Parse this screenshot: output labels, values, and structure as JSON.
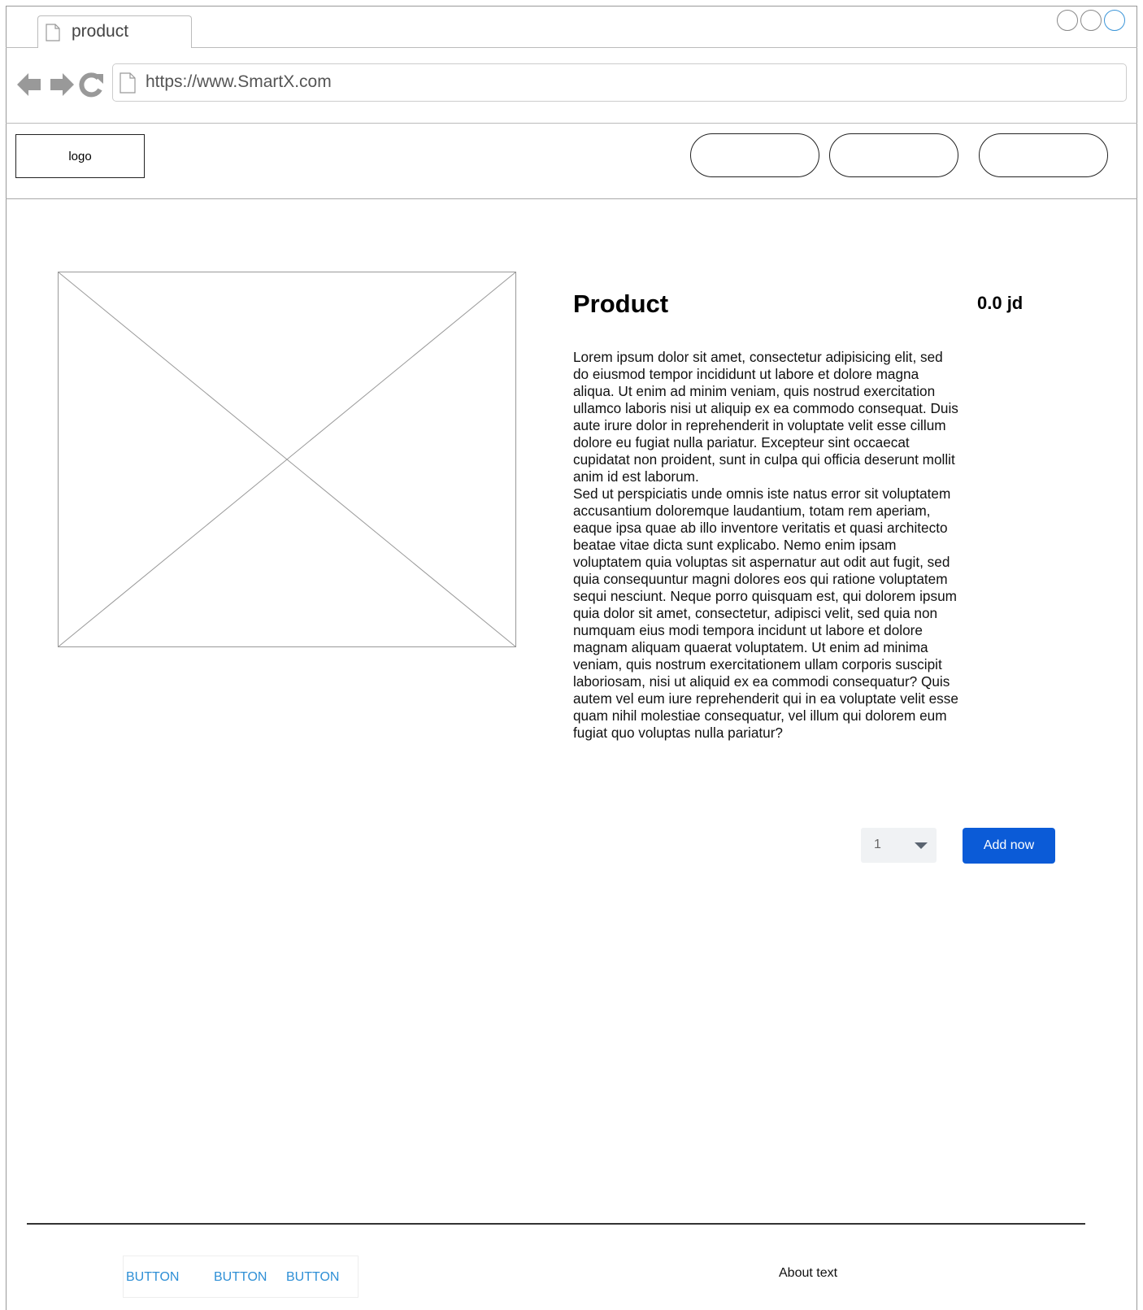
{
  "browser": {
    "tab_title": "product",
    "url": "https://www.SmartX.com"
  },
  "header": {
    "logo_label": "logo"
  },
  "product": {
    "title": "Product",
    "price": "0.0 jd",
    "description": "Lorem ipsum dolor sit amet, consectetur adipisicing elit, sed\ndo eiusmod tempor incididunt ut labore et dolore magna\naliqua. Ut enim ad minim veniam, quis nostrud exercitation\nullamco laboris nisi ut aliquip ex ea commodo consequat. Duis\naute irure dolor in reprehenderit in voluptate velit esse cillum\ndolore eu fugiat nulla pariatur. Excepteur sint occaecat\ncupidatat non proident, sunt in culpa qui officia deserunt mollit\nanim id est laborum.\nSed ut perspiciatis unde omnis iste natus error sit voluptatem\naccusantium doloremque laudantium, totam rem aperiam,\neaque ipsa quae ab illo inventore veritatis et quasi architecto\nbeatae vitae dicta sunt explicabo. Nemo enim ipsam\nvoluptatem quia voluptas sit aspernatur aut odit aut fugit, sed\nquia consequuntur magni dolores eos qui ratione voluptatem\nsequi nesciunt. Neque porro quisquam est, qui dolorem ipsum\nquia dolor sit amet, consectetur, adipisci velit, sed quia non\nnumquam eius modi tempora incidunt ut labore et dolore\nmagnam aliquam quaerat voluptatem. Ut enim ad minima\nveniam, quis nostrum exercitationem ullam corporis suscipit\nlaboriosam, nisi ut aliquid ex ea commodi consequatur? Quis\nautem vel eum iure reprehenderit qui in ea voluptate velit esse\nquam nihil molestiae consequatur, vel illum qui dolorem eum\nfugiat quo voluptas nulla pariatur?",
    "quantity": "1",
    "add_button_label": "Add now",
    "add_button_color": "#0b5bd7"
  },
  "footer": {
    "buttons": [
      "BUTTON",
      "BUTTON",
      "BUTTON"
    ],
    "button_color": "#2e8fd6",
    "about_text": "About text"
  },
  "icons": {
    "tab": "document-icon",
    "back": "back-arrow-icon",
    "forward": "forward-arrow-icon",
    "reload": "reload-icon",
    "url": "document-icon",
    "image": "image-placeholder-icon"
  }
}
